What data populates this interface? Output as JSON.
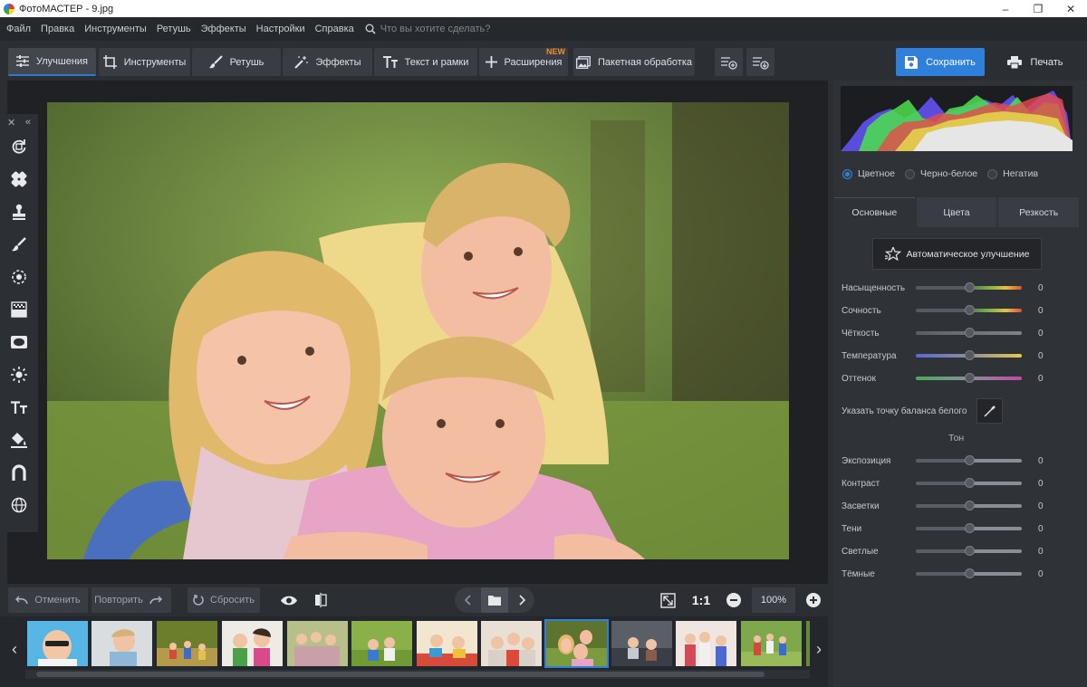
{
  "window": {
    "title": "ФотоМАСТЕР - 9.jpg",
    "minimize": "–",
    "maximize": "❐",
    "close": "✕"
  },
  "menu": {
    "items": [
      "Файл",
      "Правка",
      "Инструменты",
      "Ретушь",
      "Эффекты",
      "Настройки",
      "Справка"
    ],
    "search_placeholder": "Что вы хотите сделать?"
  },
  "toolbar": {
    "tabs": [
      "Улучшения",
      "Инструменты",
      "Ретушь",
      "Эффекты",
      "Текст и рамки",
      "Расширения",
      "Пакетная обработка"
    ],
    "new_badge": "NEW",
    "save_label": "Сохранить",
    "print_label": "Печать"
  },
  "left_tools": {
    "close": "✕",
    "collapse": "«",
    "icons": [
      "rotate-icon",
      "patch-icon",
      "stamp-icon",
      "brush-icon",
      "radial-icon",
      "gradient-icon",
      "vignette-icon",
      "light-icon",
      "text-icon",
      "fill-icon",
      "pen-icon",
      "globe-icon"
    ]
  },
  "bottom": {
    "undo_label": "Отменить",
    "redo_label": "Повторить",
    "reset_label": "Сбросить",
    "one_to_one": "1:1",
    "zoom": "100%"
  },
  "filmstrip": {
    "left": "‹",
    "right": "›",
    "thumbnail_count": 13,
    "selected_index": 8
  },
  "panel": {
    "modes": [
      "Цветное",
      "Черно-белое",
      "Негатив"
    ],
    "selected_mode": "Цветное",
    "tabs": [
      "Основные",
      "Цвета",
      "Резкость"
    ],
    "auto_label": "Автоматическое улучшение",
    "basic_sliders": [
      {
        "label": "Насыщенность",
        "value": "0",
        "track": "linear-gradient(90deg,#555a60 0%,#555a60 45%,#6fa84a 65%,#e0c442 85%,#e24c3a 100%)"
      },
      {
        "label": "Сочность",
        "value": "0",
        "track": "linear-gradient(90deg,#555a60 0%,#555a60 45%,#6fa84a 65%,#e0c442 85%,#e24c3a 100%)"
      },
      {
        "label": "Чёткость",
        "value": "0",
        "track": "linear-gradient(90deg,#5a5e64,#7e838a)"
      },
      {
        "label": "Температура",
        "value": "0",
        "track": "linear-gradient(90deg,#5a68d6,#8a9099 50%,#e7c948)"
      },
      {
        "label": "Оттенок",
        "value": "0",
        "track": "linear-gradient(90deg,#4aa85c,#8a8f98 50%,#c24aa0)"
      }
    ],
    "wb_label": "Указать точку баланса белого",
    "tone_title": "Тон",
    "tone_sliders": [
      {
        "label": "Экспозиция",
        "value": "0"
      },
      {
        "label": "Контраст",
        "value": "0"
      },
      {
        "label": "Засветки",
        "value": "0"
      },
      {
        "label": "Тени",
        "value": "0"
      },
      {
        "label": "Светлые",
        "value": "0"
      },
      {
        "label": "Тёмные",
        "value": "0"
      }
    ]
  },
  "colors": {
    "accent": "#2f80db",
    "badge": "#f28a2c",
    "bg": "#2b2e33",
    "panel": "#2f3237"
  }
}
